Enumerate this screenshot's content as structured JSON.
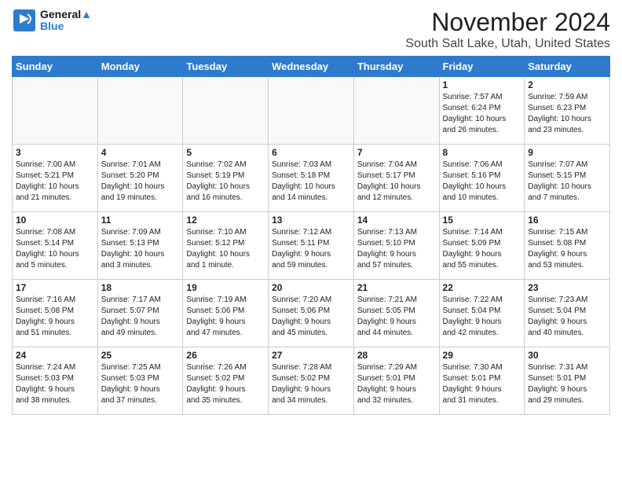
{
  "logo": {
    "line1": "General",
    "line2": "Blue"
  },
  "header": {
    "month": "November 2024",
    "location": "South Salt Lake, Utah, United States"
  },
  "weekdays": [
    "Sunday",
    "Monday",
    "Tuesday",
    "Wednesday",
    "Thursday",
    "Friday",
    "Saturday"
  ],
  "weeks": [
    [
      {
        "day": "",
        "info": ""
      },
      {
        "day": "",
        "info": ""
      },
      {
        "day": "",
        "info": ""
      },
      {
        "day": "",
        "info": ""
      },
      {
        "day": "",
        "info": ""
      },
      {
        "day": "1",
        "info": "Sunrise: 7:57 AM\nSunset: 6:24 PM\nDaylight: 10 hours\nand 26 minutes."
      },
      {
        "day": "2",
        "info": "Sunrise: 7:59 AM\nSunset: 6:23 PM\nDaylight: 10 hours\nand 23 minutes."
      }
    ],
    [
      {
        "day": "3",
        "info": "Sunrise: 7:00 AM\nSunset: 5:21 PM\nDaylight: 10 hours\nand 21 minutes."
      },
      {
        "day": "4",
        "info": "Sunrise: 7:01 AM\nSunset: 5:20 PM\nDaylight: 10 hours\nand 19 minutes."
      },
      {
        "day": "5",
        "info": "Sunrise: 7:02 AM\nSunset: 5:19 PM\nDaylight: 10 hours\nand 16 minutes."
      },
      {
        "day": "6",
        "info": "Sunrise: 7:03 AM\nSunset: 5:18 PM\nDaylight: 10 hours\nand 14 minutes."
      },
      {
        "day": "7",
        "info": "Sunrise: 7:04 AM\nSunset: 5:17 PM\nDaylight: 10 hours\nand 12 minutes."
      },
      {
        "day": "8",
        "info": "Sunrise: 7:06 AM\nSunset: 5:16 PM\nDaylight: 10 hours\nand 10 minutes."
      },
      {
        "day": "9",
        "info": "Sunrise: 7:07 AM\nSunset: 5:15 PM\nDaylight: 10 hours\nand 7 minutes."
      }
    ],
    [
      {
        "day": "10",
        "info": "Sunrise: 7:08 AM\nSunset: 5:14 PM\nDaylight: 10 hours\nand 5 minutes."
      },
      {
        "day": "11",
        "info": "Sunrise: 7:09 AM\nSunset: 5:13 PM\nDaylight: 10 hours\nand 3 minutes."
      },
      {
        "day": "12",
        "info": "Sunrise: 7:10 AM\nSunset: 5:12 PM\nDaylight: 10 hours\nand 1 minute."
      },
      {
        "day": "13",
        "info": "Sunrise: 7:12 AM\nSunset: 5:11 PM\nDaylight: 9 hours\nand 59 minutes."
      },
      {
        "day": "14",
        "info": "Sunrise: 7:13 AM\nSunset: 5:10 PM\nDaylight: 9 hours\nand 57 minutes."
      },
      {
        "day": "15",
        "info": "Sunrise: 7:14 AM\nSunset: 5:09 PM\nDaylight: 9 hours\nand 55 minutes."
      },
      {
        "day": "16",
        "info": "Sunrise: 7:15 AM\nSunset: 5:08 PM\nDaylight: 9 hours\nand 53 minutes."
      }
    ],
    [
      {
        "day": "17",
        "info": "Sunrise: 7:16 AM\nSunset: 5:08 PM\nDaylight: 9 hours\nand 51 minutes."
      },
      {
        "day": "18",
        "info": "Sunrise: 7:17 AM\nSunset: 5:07 PM\nDaylight: 9 hours\nand 49 minutes."
      },
      {
        "day": "19",
        "info": "Sunrise: 7:19 AM\nSunset: 5:06 PM\nDaylight: 9 hours\nand 47 minutes."
      },
      {
        "day": "20",
        "info": "Sunrise: 7:20 AM\nSunset: 5:06 PM\nDaylight: 9 hours\nand 45 minutes."
      },
      {
        "day": "21",
        "info": "Sunrise: 7:21 AM\nSunset: 5:05 PM\nDaylight: 9 hours\nand 44 minutes."
      },
      {
        "day": "22",
        "info": "Sunrise: 7:22 AM\nSunset: 5:04 PM\nDaylight: 9 hours\nand 42 minutes."
      },
      {
        "day": "23",
        "info": "Sunrise: 7:23 AM\nSunset: 5:04 PM\nDaylight: 9 hours\nand 40 minutes."
      }
    ],
    [
      {
        "day": "24",
        "info": "Sunrise: 7:24 AM\nSunset: 5:03 PM\nDaylight: 9 hours\nand 38 minutes."
      },
      {
        "day": "25",
        "info": "Sunrise: 7:25 AM\nSunset: 5:03 PM\nDaylight: 9 hours\nand 37 minutes."
      },
      {
        "day": "26",
        "info": "Sunrise: 7:26 AM\nSunset: 5:02 PM\nDaylight: 9 hours\nand 35 minutes."
      },
      {
        "day": "27",
        "info": "Sunrise: 7:28 AM\nSunset: 5:02 PM\nDaylight: 9 hours\nand 34 minutes."
      },
      {
        "day": "28",
        "info": "Sunrise: 7:29 AM\nSunset: 5:01 PM\nDaylight: 9 hours\nand 32 minutes."
      },
      {
        "day": "29",
        "info": "Sunrise: 7:30 AM\nSunset: 5:01 PM\nDaylight: 9 hours\nand 31 minutes."
      },
      {
        "day": "30",
        "info": "Sunrise: 7:31 AM\nSunset: 5:01 PM\nDaylight: 9 hours\nand 29 minutes."
      }
    ]
  ]
}
